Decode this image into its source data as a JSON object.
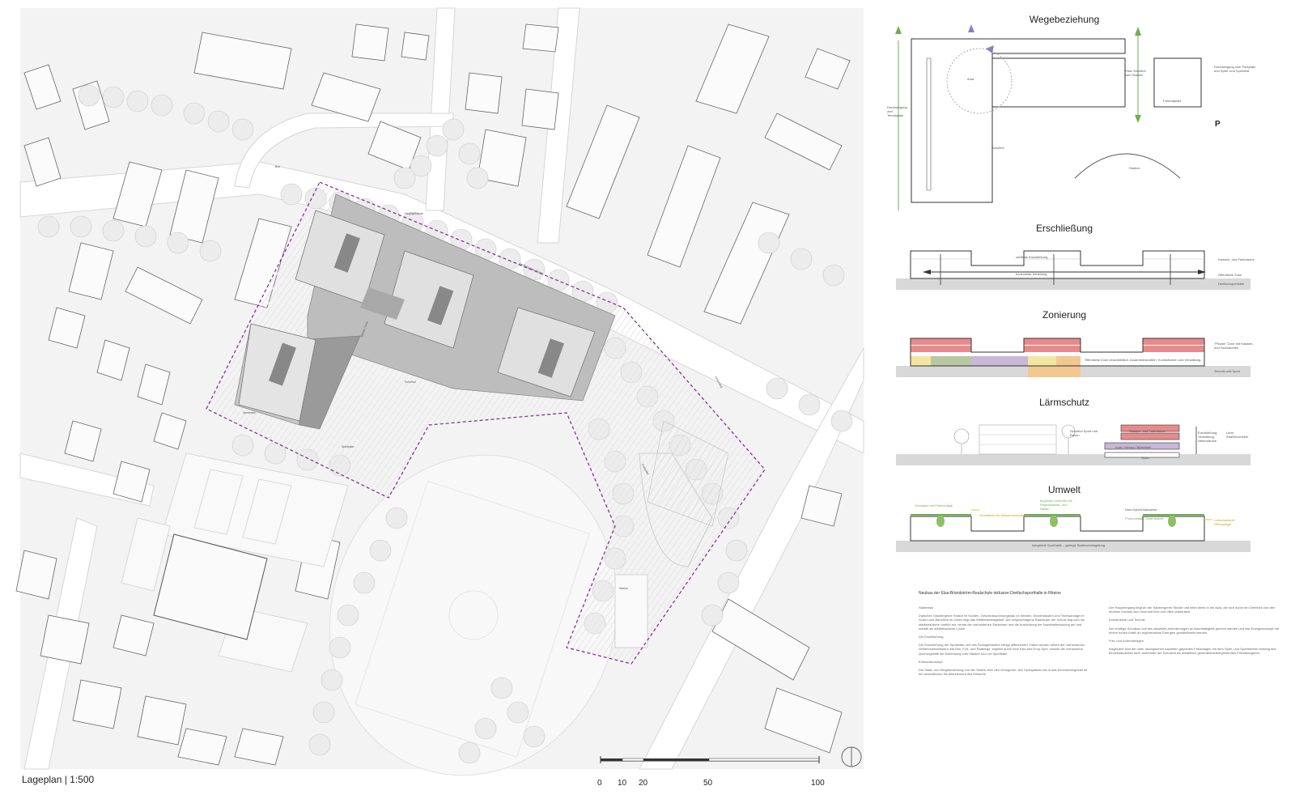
{
  "plan": {
    "caption": "Lageplan | 1:500",
    "scale_labels": [
      "0",
      "10",
      "20",
      "50",
      "100"
    ],
    "street_labels": [
      "Salzbergener Straße",
      "Bus",
      "Grenzweg"
    ],
    "area_labels": [
      "Hauptgebäude",
      "Mensa / Aula",
      "Schulhof",
      "Parkplatz",
      "Sporthalle",
      "Station",
      "Spielplatz"
    ]
  },
  "panels": [
    {
      "title": "Wegebeziehung",
      "notes": [
        "Durchwegung zum Tennisplatz",
        "Platz Schulhof zum Stadion",
        "Durchwegung zum Parkplatz und Spiel- und Sportfeld",
        "Aula",
        "Schulhof",
        "Fahrradplatz",
        "Stadion",
        "P"
      ]
    },
    {
      "title": "Erschließung",
      "notes": [
        "vertikale Erschließung",
        "horizontale Verteilung",
        "Klassen- und Fachräume",
        "Öffentliche Zone",
        "Dreifachsporthalle"
      ]
    },
    {
      "title": "Zonierung",
      "notes": [
        "\"Private\" Zone mit Klassen- und Fachräumen",
        "Öffentliche Zone einschließlich Zusammenkünften, Kunsträumen und Verwaltung",
        "Technik und Sport"
      ]
    },
    {
      "title": "Lärmschutz",
      "notes": [
        "Klassen- und Fachräume",
        "Aula / Mensa / Bibliothek",
        "Sport",
        "Schulhof Sport und Rasen",
        "Erschließung, Verwaltung, Nebenräume",
        "Lärm Straßenverkehr"
      ]
    },
    {
      "title": "Umwelt",
      "notes": [
        "Gründach mit Photovoltaik",
        "Grünfläche für Wasserrückhaltung",
        "begrünte Lichthöfe mit Regenwasser- und Rasen",
        "Holz-Hybrid-Bauweise",
        "Photovoltaik / Solarmodule",
        "Luftschadstoff-Filteranlage",
        "integrierte Sporthalle – geringe Bodenversiegelung"
      ]
    }
  ],
  "description": {
    "title": "Neubau der Elsa-Brändström-Realschule inklusive Dreifachsporthalle in Rheine",
    "col1": [
      "Städtebau",
      "Zwischen Salzbergener Straße im Norden, Geschosswohnungsbau im Westen, Einzelhäusern und Tennisanlage im Süden und Bahnlinie im Osten liegt das Wettbewerbsgebiet. Die vorgeschlagene Baukörper der Schule fügt sich ins städtebauliche Umfeld ein, nimmt die vorhandenen Strukturen und die Ausrichtung der Nachbarbebauung auf und schafft die städtebauliche Lücke.",
      "Die Erschließung",
      "Die Erschließung der Sporthalle und des Schulgebäudes erfolgt differenziert. Dabei werden neben der vorhandenen Verkehrsinfrastruktur wie Bus, Fuß- und Radwege, ergänzt durch eine Kiss and Drop-Spur, sowohl die vorhandene Querungshilfe mit Einbindung zum Stadion und zur Sporthalle.",
      "Entwurfskonzept",
      "Die Stadt- und Wegebeziehung von der Straße über den Grüngürtel, den Sportplätzen bis in das Einzelwohngebiet ist ein wesentliches Strukturelement des Entwurfs."
    ],
    "col2": [
      "Der Haupteingang liegt an der Salzbergener Straße und leitet direkt in die Aula, die sich durch ein Oberlicht und den direkten Kontakt zum Innenhof licht und offen präsentiert.",
      "Konstruktion und Technik",
      "Der künftige Schulbau soll den aktuellen Anforderungen an Nachhaltigkeit gerecht werden und das Energiekonzept mit einem hohen Anteil an regenerativen Energien gewährleistet werden.",
      "Frei- und Außenanlagen",
      "Insgesamt sind die unter ökologischen Aspekten geplanten Freianlagen mit dem Spiel- und Sportbereich entlang des Einzelstandortes auch außerhalb der Schulzeit ein attraktives generationsübergreifendes Freizeitangebot."
    ]
  },
  "colors": {
    "accent_boundary": "#7a2a8a",
    "private_zone": "#e88a8a",
    "public_zone_green": "#b8c8a0",
    "public_zone_purple": "#c8b8d8",
    "public_zone_yellow": "#f2e6a0",
    "public_zone_orange": "#f2c890",
    "arrow_green": "#6ab04c",
    "arrow_purple": "#8e7cc3"
  }
}
